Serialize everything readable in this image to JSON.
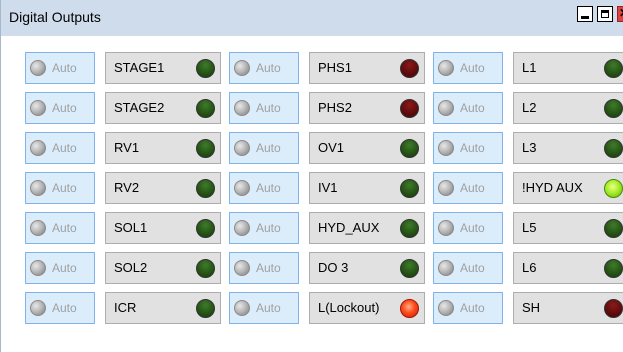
{
  "window": {
    "title": "Digital Outputs",
    "controls": [
      "minimize-icon",
      "maximize-icon",
      "close-icon"
    ],
    "colors": {
      "titlebar": "#cfdcec",
      "auto_button": "#dbecfb",
      "output_button": "#e1e1e1"
    }
  },
  "auto_label": "Auto",
  "columns": [
    {
      "outputs": [
        {
          "label": "STAGE1",
          "led": "green-off"
        },
        {
          "label": "STAGE2",
          "led": "green-off"
        },
        {
          "label": "RV1",
          "led": "green-off"
        },
        {
          "label": "RV2",
          "led": "green-off"
        },
        {
          "label": "SOL1",
          "led": "green-off"
        },
        {
          "label": "SOL2",
          "led": "green-off"
        },
        {
          "label": "ICR",
          "led": "green-off"
        }
      ]
    },
    {
      "outputs": [
        {
          "label": "PHS1",
          "led": "red-off"
        },
        {
          "label": "PHS2",
          "led": "red-off"
        },
        {
          "label": "OV1",
          "led": "green-off"
        },
        {
          "label": "IV1",
          "led": "green-off"
        },
        {
          "label": "HYD_AUX",
          "led": "green-off"
        },
        {
          "label": "DO 3",
          "led": "green-off"
        },
        {
          "label": "L(Lockout)",
          "led": "red-on"
        }
      ]
    },
    {
      "outputs": [
        {
          "label": "L1",
          "led": "green-off"
        },
        {
          "label": "L2",
          "led": "green-off"
        },
        {
          "label": "L3",
          "led": "green-off"
        },
        {
          "label": "!HYD AUX",
          "led": "green-on"
        },
        {
          "label": "L5",
          "led": "green-off"
        },
        {
          "label": "L6",
          "led": "green-off"
        },
        {
          "label": "SH",
          "led": "red-off"
        }
      ]
    }
  ]
}
